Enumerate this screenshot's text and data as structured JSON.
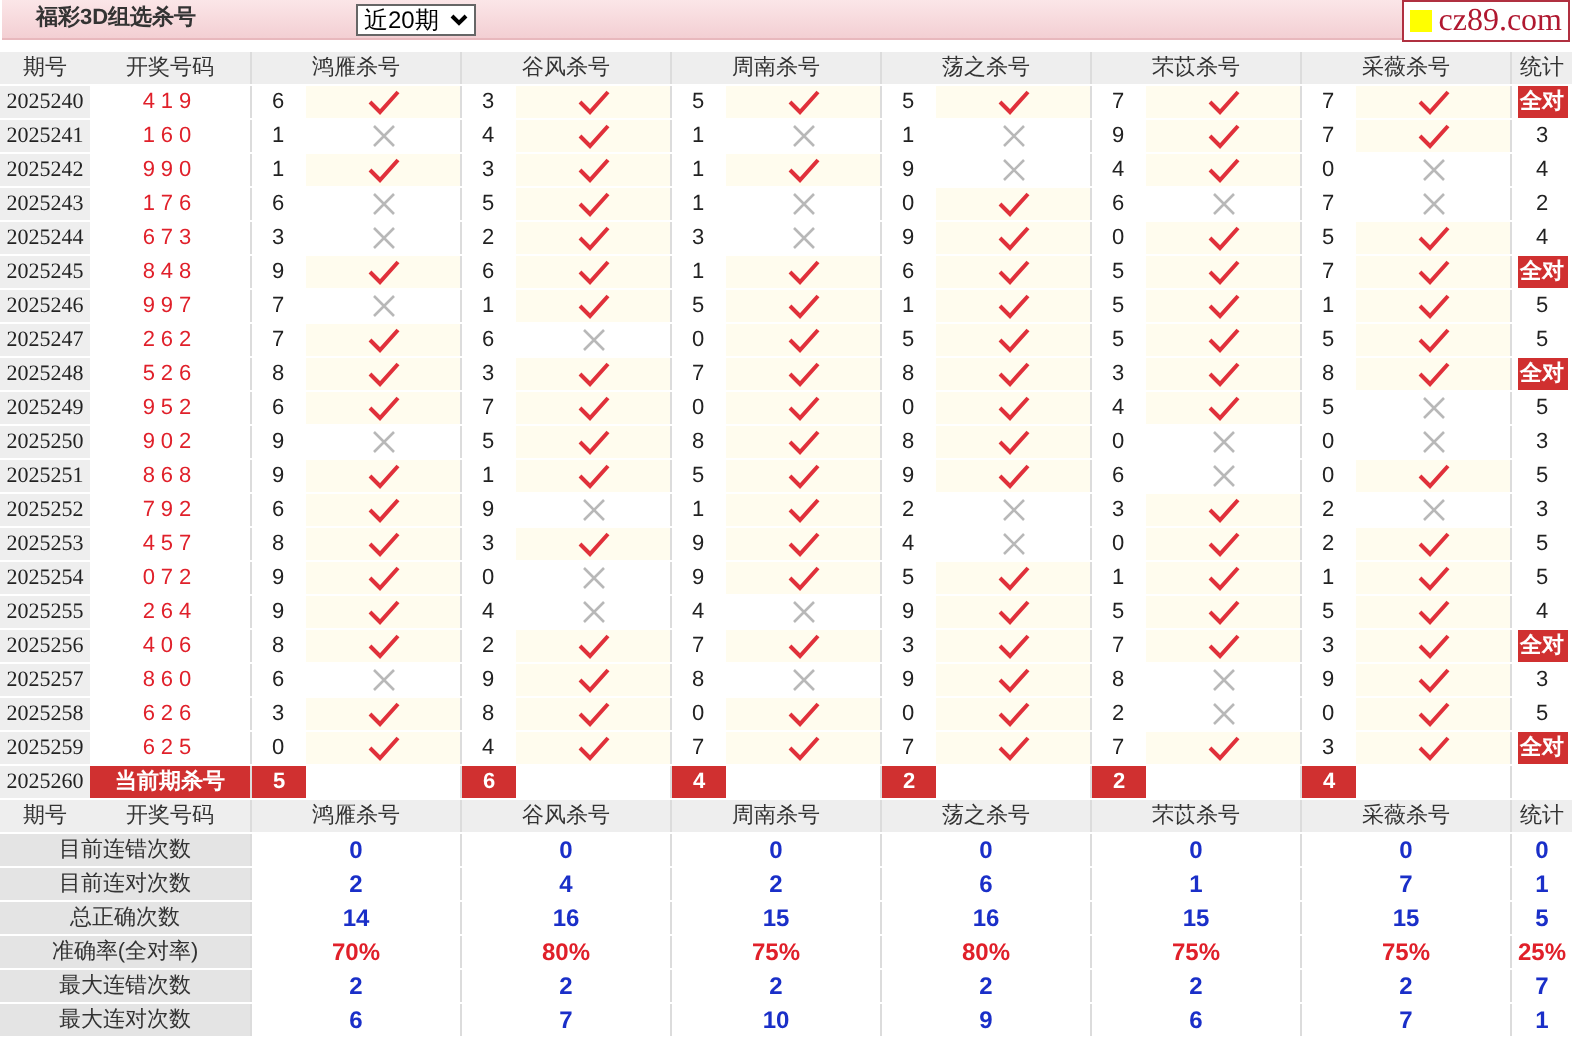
{
  "header": {
    "title": "福彩3D组选杀号",
    "period_select": {
      "value": "近20期"
    },
    "logo": "cz89.com"
  },
  "columns": [
    "期号",
    "开奖号码",
    "鸿雁杀号",
    "谷风杀号",
    "周南杀号",
    "荡之杀号",
    "芣苡杀号",
    "采薇杀号",
    "统计"
  ],
  "rows": [
    {
      "issue": "2025240",
      "draw": "419",
      "kills": [
        {
          "number": "6",
          "correct": true
        },
        {
          "number": "3",
          "correct": true
        },
        {
          "number": "5",
          "correct": true
        },
        {
          "number": "5",
          "correct": true
        },
        {
          "number": "7",
          "correct": true
        },
        {
          "number": "7",
          "correct": true
        }
      ],
      "tally": {
        "kind": "all",
        "text": "全对"
      }
    },
    {
      "issue": "2025241",
      "draw": "160",
      "kills": [
        {
          "number": "1",
          "correct": false
        },
        {
          "number": "4",
          "correct": true
        },
        {
          "number": "1",
          "correct": false
        },
        {
          "number": "1",
          "correct": false
        },
        {
          "number": "9",
          "correct": true
        },
        {
          "number": "7",
          "correct": true
        }
      ],
      "tally": {
        "kind": "count",
        "text": "3"
      }
    },
    {
      "issue": "2025242",
      "draw": "990",
      "kills": [
        {
          "number": "1",
          "correct": true
        },
        {
          "number": "3",
          "correct": true
        },
        {
          "number": "1",
          "correct": true
        },
        {
          "number": "9",
          "correct": false
        },
        {
          "number": "4",
          "correct": true
        },
        {
          "number": "0",
          "correct": false
        }
      ],
      "tally": {
        "kind": "count",
        "text": "4"
      }
    },
    {
      "issue": "2025243",
      "draw": "176",
      "kills": [
        {
          "number": "6",
          "correct": false
        },
        {
          "number": "5",
          "correct": true
        },
        {
          "number": "1",
          "correct": false
        },
        {
          "number": "0",
          "correct": true
        },
        {
          "number": "6",
          "correct": false
        },
        {
          "number": "7",
          "correct": false
        }
      ],
      "tally": {
        "kind": "count",
        "text": "2"
      }
    },
    {
      "issue": "2025244",
      "draw": "673",
      "kills": [
        {
          "number": "3",
          "correct": false
        },
        {
          "number": "2",
          "correct": true
        },
        {
          "number": "3",
          "correct": false
        },
        {
          "number": "9",
          "correct": true
        },
        {
          "number": "0",
          "correct": true
        },
        {
          "number": "5",
          "correct": true
        }
      ],
      "tally": {
        "kind": "count",
        "text": "4"
      }
    },
    {
      "issue": "2025245",
      "draw": "848",
      "kills": [
        {
          "number": "9",
          "correct": true
        },
        {
          "number": "6",
          "correct": true
        },
        {
          "number": "1",
          "correct": true
        },
        {
          "number": "6",
          "correct": true
        },
        {
          "number": "5",
          "correct": true
        },
        {
          "number": "7",
          "correct": true
        }
      ],
      "tally": {
        "kind": "all",
        "text": "全对"
      }
    },
    {
      "issue": "2025246",
      "draw": "997",
      "kills": [
        {
          "number": "7",
          "correct": false
        },
        {
          "number": "1",
          "correct": true
        },
        {
          "number": "5",
          "correct": true
        },
        {
          "number": "1",
          "correct": true
        },
        {
          "number": "5",
          "correct": true
        },
        {
          "number": "1",
          "correct": true
        }
      ],
      "tally": {
        "kind": "count",
        "text": "5"
      }
    },
    {
      "issue": "2025247",
      "draw": "262",
      "kills": [
        {
          "number": "7",
          "correct": true
        },
        {
          "number": "6",
          "correct": false
        },
        {
          "number": "0",
          "correct": true
        },
        {
          "number": "5",
          "correct": true
        },
        {
          "number": "5",
          "correct": true
        },
        {
          "number": "5",
          "correct": true
        }
      ],
      "tally": {
        "kind": "count",
        "text": "5"
      }
    },
    {
      "issue": "2025248",
      "draw": "526",
      "kills": [
        {
          "number": "8",
          "correct": true
        },
        {
          "number": "3",
          "correct": true
        },
        {
          "number": "7",
          "correct": true
        },
        {
          "number": "8",
          "correct": true
        },
        {
          "number": "3",
          "correct": true
        },
        {
          "number": "8",
          "correct": true
        }
      ],
      "tally": {
        "kind": "all",
        "text": "全对"
      }
    },
    {
      "issue": "2025249",
      "draw": "952",
      "kills": [
        {
          "number": "6",
          "correct": true
        },
        {
          "number": "7",
          "correct": true
        },
        {
          "number": "0",
          "correct": true
        },
        {
          "number": "0",
          "correct": true
        },
        {
          "number": "4",
          "correct": true
        },
        {
          "number": "5",
          "correct": false
        }
      ],
      "tally": {
        "kind": "count",
        "text": "5"
      }
    },
    {
      "issue": "2025250",
      "draw": "902",
      "kills": [
        {
          "number": "9",
          "correct": false
        },
        {
          "number": "5",
          "correct": true
        },
        {
          "number": "8",
          "correct": true
        },
        {
          "number": "8",
          "correct": true
        },
        {
          "number": "0",
          "correct": false
        },
        {
          "number": "0",
          "correct": false
        }
      ],
      "tally": {
        "kind": "count",
        "text": "3"
      }
    },
    {
      "issue": "2025251",
      "draw": "868",
      "kills": [
        {
          "number": "9",
          "correct": true
        },
        {
          "number": "1",
          "correct": true
        },
        {
          "number": "5",
          "correct": true
        },
        {
          "number": "9",
          "correct": true
        },
        {
          "number": "6",
          "correct": false
        },
        {
          "number": "0",
          "correct": true
        }
      ],
      "tally": {
        "kind": "count",
        "text": "5"
      }
    },
    {
      "issue": "2025252",
      "draw": "792",
      "kills": [
        {
          "number": "6",
          "correct": true
        },
        {
          "number": "9",
          "correct": false
        },
        {
          "number": "1",
          "correct": true
        },
        {
          "number": "2",
          "correct": false
        },
        {
          "number": "3",
          "correct": true
        },
        {
          "number": "2",
          "correct": false
        }
      ],
      "tally": {
        "kind": "count",
        "text": "3"
      }
    },
    {
      "issue": "2025253",
      "draw": "457",
      "kills": [
        {
          "number": "8",
          "correct": true
        },
        {
          "number": "3",
          "correct": true
        },
        {
          "number": "9",
          "correct": true
        },
        {
          "number": "4",
          "correct": false
        },
        {
          "number": "0",
          "correct": true
        },
        {
          "number": "2",
          "correct": true
        }
      ],
      "tally": {
        "kind": "count",
        "text": "5"
      }
    },
    {
      "issue": "2025254",
      "draw": "072",
      "kills": [
        {
          "number": "9",
          "correct": true
        },
        {
          "number": "0",
          "correct": false
        },
        {
          "number": "9",
          "correct": true
        },
        {
          "number": "5",
          "correct": true
        },
        {
          "number": "1",
          "correct": true
        },
        {
          "number": "1",
          "correct": true
        }
      ],
      "tally": {
        "kind": "count",
        "text": "5"
      }
    },
    {
      "issue": "2025255",
      "draw": "264",
      "kills": [
        {
          "number": "9",
          "correct": true
        },
        {
          "number": "4",
          "correct": false
        },
        {
          "number": "4",
          "correct": false
        },
        {
          "number": "9",
          "correct": true
        },
        {
          "number": "5",
          "correct": true
        },
        {
          "number": "5",
          "correct": true
        }
      ],
      "tally": {
        "kind": "count",
        "text": "4"
      }
    },
    {
      "issue": "2025256",
      "draw": "406",
      "kills": [
        {
          "number": "8",
          "correct": true
        },
        {
          "number": "2",
          "correct": true
        },
        {
          "number": "7",
          "correct": true
        },
        {
          "number": "3",
          "correct": true
        },
        {
          "number": "7",
          "correct": true
        },
        {
          "number": "3",
          "correct": true
        }
      ],
      "tally": {
        "kind": "all",
        "text": "全对"
      }
    },
    {
      "issue": "2025257",
      "draw": "860",
      "kills": [
        {
          "number": "6",
          "correct": false
        },
        {
          "number": "9",
          "correct": true
        },
        {
          "number": "8",
          "correct": false
        },
        {
          "number": "9",
          "correct": true
        },
        {
          "number": "8",
          "correct": false
        },
        {
          "number": "9",
          "correct": true
        }
      ],
      "tally": {
        "kind": "count",
        "text": "3"
      }
    },
    {
      "issue": "2025258",
      "draw": "626",
      "kills": [
        {
          "number": "3",
          "correct": true
        },
        {
          "number": "8",
          "correct": true
        },
        {
          "number": "0",
          "correct": true
        },
        {
          "number": "0",
          "correct": true
        },
        {
          "number": "2",
          "correct": false
        },
        {
          "number": "0",
          "correct": true
        }
      ],
      "tally": {
        "kind": "count",
        "text": "5"
      }
    },
    {
      "issue": "2025259",
      "draw": "625",
      "kills": [
        {
          "number": "0",
          "correct": true
        },
        {
          "number": "4",
          "correct": true
        },
        {
          "number": "7",
          "correct": true
        },
        {
          "number": "7",
          "correct": true
        },
        {
          "number": "7",
          "correct": true
        },
        {
          "number": "3",
          "correct": true
        }
      ],
      "tally": {
        "kind": "all",
        "text": "全对"
      }
    }
  ],
  "current": {
    "issue": "2025260",
    "label": "当前期杀号",
    "kills": [
      "5",
      "6",
      "4",
      "2",
      "2",
      "4"
    ]
  },
  "footer_columns": [
    "期号",
    "开奖号码",
    "鸿雁杀号",
    "谷风杀号",
    "周南杀号",
    "荡之杀号",
    "芣苡杀号",
    "采薇杀号",
    "统计"
  ],
  "stats": [
    {
      "label": "目前连错次数",
      "kind": "count",
      "values": [
        "0",
        "0",
        "0",
        "0",
        "0",
        "0",
        "0"
      ]
    },
    {
      "label": "目前连对次数",
      "kind": "count",
      "values": [
        "2",
        "4",
        "2",
        "6",
        "1",
        "7",
        "1"
      ]
    },
    {
      "label": "总正确次数",
      "kind": "count",
      "values": [
        "14",
        "16",
        "15",
        "16",
        "15",
        "15",
        "5"
      ]
    },
    {
      "label": "准确率(全对率)",
      "kind": "rate",
      "values": [
        "70%",
        "80%",
        "75%",
        "80%",
        "75%",
        "75%",
        "25%"
      ]
    },
    {
      "label": "最大连错次数",
      "kind": "count",
      "values": [
        "2",
        "2",
        "2",
        "2",
        "2",
        "2",
        "7"
      ]
    },
    {
      "label": "最大连对次数",
      "kind": "count",
      "values": [
        "6",
        "7",
        "10",
        "9",
        "6",
        "7",
        "1"
      ]
    }
  ]
}
